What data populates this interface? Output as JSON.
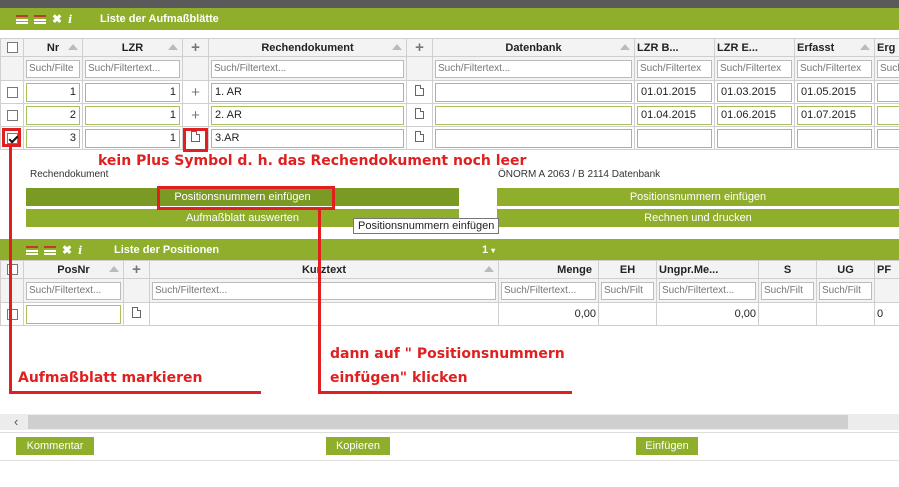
{
  "panel1": {
    "title": "Liste der Aufmaßblätte",
    "columns": [
      "Nr",
      "LZR",
      "Rechendokument",
      "Datenbank",
      "LZR B...",
      "LZR E...",
      "Erfasst",
      "Erg"
    ],
    "filter_placeholders": {
      "nr": "Such/Filte",
      "lzr": "Such/Filtertext...",
      "rechendokument": "Such/Filtertext...",
      "datenbank": "Such/Filtertext...",
      "lzr_b": "Such/Filtertex",
      "lzr_e": "Such/Filtertex",
      "erfasst": "Such/Filtertex",
      "erg": "Such"
    },
    "rows": [
      {
        "checked": false,
        "nr": "1",
        "lzr": "1",
        "has_plus": true,
        "rechendokument": "1. AR",
        "lzr_b": "01.01.2015",
        "lzr_e": "01.03.2015",
        "erfasst": "01.05.2015"
      },
      {
        "checked": false,
        "nr": "2",
        "lzr": "1",
        "has_plus": true,
        "rechendokument": "2. AR",
        "lzr_b": "01.04.2015",
        "lzr_e": "01.06.2015",
        "erfasst": "01.07.2015"
      },
      {
        "checked": true,
        "nr": "3",
        "lzr": "1",
        "has_plus": false,
        "rechendokument": "3.AR",
        "lzr_b": "",
        "lzr_e": "",
        "erfasst": ""
      }
    ]
  },
  "detail": {
    "left_label": "Rechendokument",
    "right_label": "ÖNORM A 2063 / B 2114 Datenbank",
    "btn_positionsnummern_left": "Positionsnummern einfügen",
    "btn_aufmassblatt_auswerten": "Aufmaßblatt auswerten",
    "btn_positionsnummern_right": "Positionsnummern einfügen",
    "btn_rechnen_drucken": "Rechnen und drucken",
    "tooltip": "Positionsnummern einfügen"
  },
  "panel2": {
    "title": "Liste der Positionen",
    "page_indicator": "1",
    "columns": [
      "PosNr",
      "Kurztext",
      "Menge",
      "EH",
      "Ungpr.Me...",
      "S",
      "UG",
      "PF"
    ],
    "filter_placeholders": {
      "posnr": "Such/Filtertext...",
      "kurztext": "Such/Filtertext...",
      "menge": "Such/Filtertext...",
      "eh": "Such/Filt",
      "ungpr": "Such/Filtertext...",
      "s": "Such/Filt",
      "ug": "Such/Filt"
    },
    "row": {
      "posnr": "",
      "menge": "0,00",
      "ungpr": "0,00",
      "pf": "0"
    }
  },
  "annotations": {
    "note1": "kein Plus Symbol d. h. das Rechendokument noch leer",
    "note2_line1": "dann auf \" Positionsnummern",
    "note2_line2": "einfügen\" klicken",
    "note3": "Aufmaßblatt markieren"
  },
  "footer": {
    "kommentar": "Kommentar",
    "kopieren": "Kopieren",
    "einfuegen": "Einfügen"
  },
  "colors": {
    "accent_green": "#8fae2b",
    "annotation_red": "#e02020"
  }
}
